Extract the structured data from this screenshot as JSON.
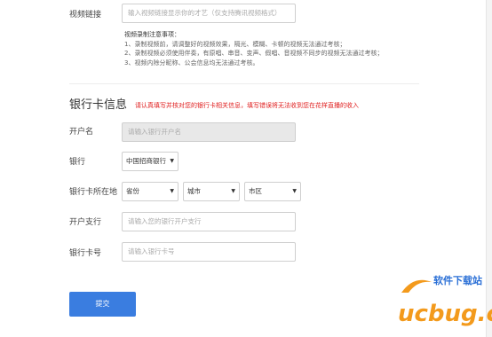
{
  "video": {
    "label": "视频链接",
    "placeholder": "输入视频链接显示你的才艺（仅支持腾讯视频格式）",
    "notes_title": "视频录制注意事项：",
    "notes": [
      "1、录制视频前，请调整好的视频效果，隔光、模糊、卡顿的视频无法通过考核；",
      "2、录制视频必须使用伴奏，有原唱、串音、变声、假唱、音视频不同步的视频无法通过考核；",
      "3、视频内除分昵称、公会信息均无法通过考核。"
    ]
  },
  "bank": {
    "section_title": "银行卡信息",
    "warning": "请认真填写并核对您的银行卡相关信息，填写错误将无法收到您在花样直播的收入",
    "account_name_label": "开户名",
    "account_name_placeholder": "请输入银行开户名",
    "bank_label": "银行",
    "bank_value": "中国招商银行",
    "location_label": "银行卡所在地",
    "province_value": "省份",
    "city_value": "城市",
    "district_value": "市区",
    "branch_label": "开户支行",
    "branch_placeholder": "请输入您的银行开户支行",
    "card_label": "银行卡号",
    "card_placeholder": "请输入银行卡号"
  },
  "actions": {
    "submit_label": "提交"
  },
  "watermark": {
    "brand_cn": "软件下载站",
    "brand_en": "ucbug.cc"
  },
  "colors": {
    "accent": "#3a7de0",
    "warning": "#e02020",
    "brand_orange": "#f39a1c",
    "brand_blue": "#2a6fd6"
  }
}
